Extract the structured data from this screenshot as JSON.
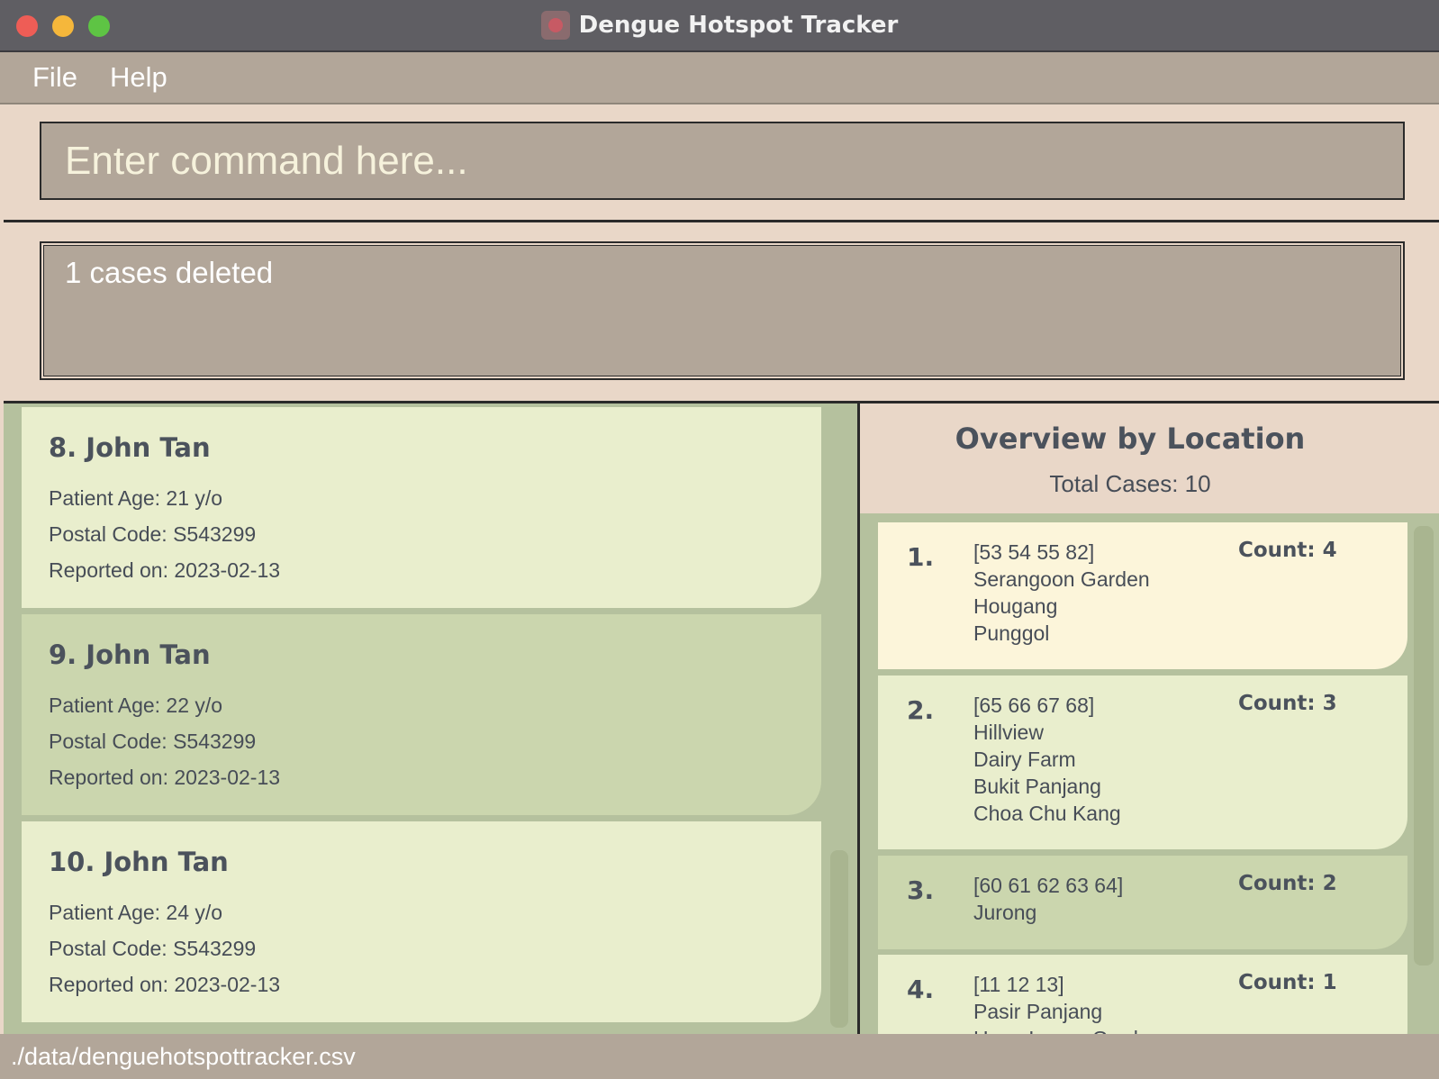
{
  "window": {
    "title": "Dengue Hotspot Tracker"
  },
  "menu": {
    "file": "File",
    "help": "Help"
  },
  "command": {
    "placeholder": "Enter command here...",
    "value": ""
  },
  "result": {
    "text": "1 cases deleted"
  },
  "cases": [
    {
      "title": "8. John Tan",
      "age": "Patient Age: 21 y/o",
      "postal": "Postal Code: S543299",
      "reported": "Reported on: 2023-02-13"
    },
    {
      "title": "9. John Tan",
      "age": "Patient Age: 22 y/o",
      "postal": "Postal Code: S543299",
      "reported": "Reported on: 2023-02-13"
    },
    {
      "title": "10. John Tan",
      "age": "Patient Age: 24 y/o",
      "postal": "Postal Code: S543299",
      "reported": "Reported on: 2023-02-13"
    }
  ],
  "overview": {
    "title": "Overview by Location",
    "total": "Total Cases: 10",
    "items": [
      {
        "num": "1.",
        "codes": "[53 54 55 82]",
        "areas": [
          "Serangoon Garden",
          "Hougang",
          "Punggol"
        ],
        "count": "Count: 4"
      },
      {
        "num": "2.",
        "codes": "[65 66 67 68]",
        "areas": [
          "Hillview",
          "Dairy Farm",
          "Bukit Panjang",
          "Choa Chu Kang"
        ],
        "count": "Count: 3"
      },
      {
        "num": "3.",
        "codes": "[60 61 62 63 64]",
        "areas": [
          "Jurong"
        ],
        "count": "Count: 2"
      },
      {
        "num": "4.",
        "codes": "[11 12 13]",
        "areas": [
          "Pasir Panjang",
          "Hong Leong Garden"
        ],
        "count": "Count: 1"
      }
    ]
  },
  "status": {
    "path": "./data/denguehotspottracker.csv"
  }
}
